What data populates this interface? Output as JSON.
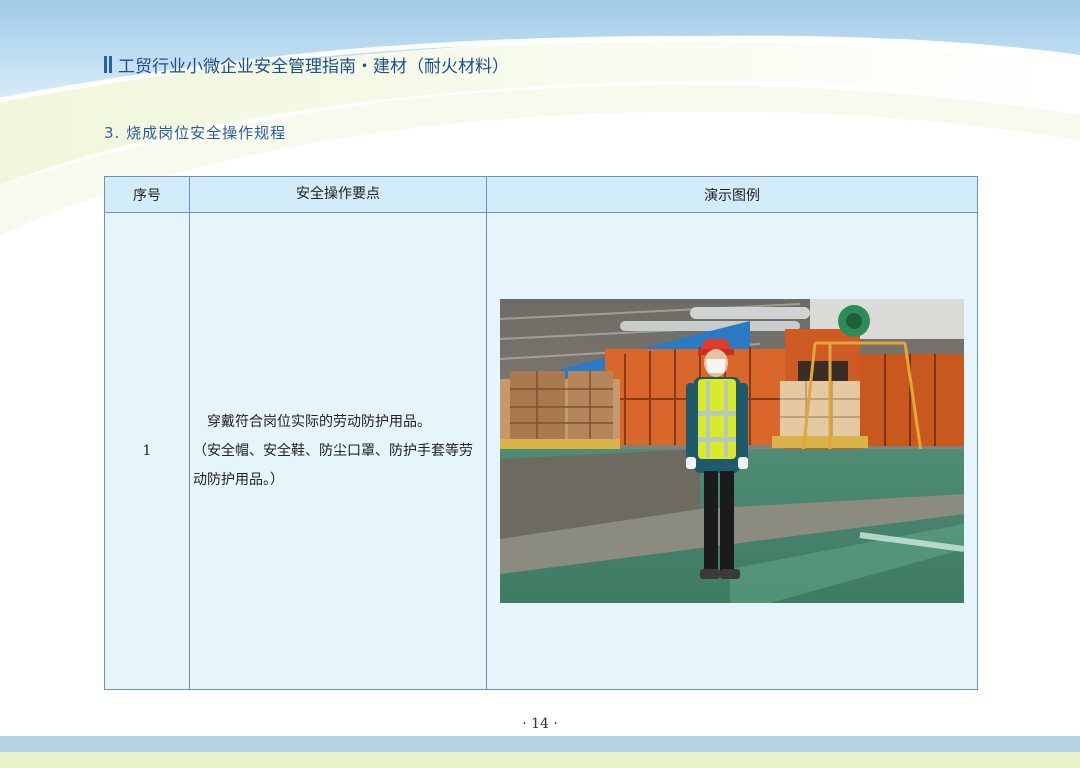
{
  "header": {
    "title": "工贸行业小微企业安全管理指南・建材（耐火材料）"
  },
  "section": {
    "title": "3. 烧成岗位安全操作规程"
  },
  "table": {
    "headers": [
      "序号",
      "安全操作要点",
      "演示图例"
    ],
    "rows": [
      {
        "number": "1",
        "text_line1": "穿戴符合岗位实际的劳动防护用品。",
        "text_line2": "（安全帽、安全鞋、防尘口罩、防护手套等劳动防护用品。）"
      }
    ]
  },
  "footer": {
    "page_number": "· 14 ·"
  },
  "colors": {
    "title_blue": "#1f4e8c",
    "table_border": "#6b92c8",
    "table_fill": "#e6f4fc",
    "header_fill": "#d3ecf9"
  }
}
